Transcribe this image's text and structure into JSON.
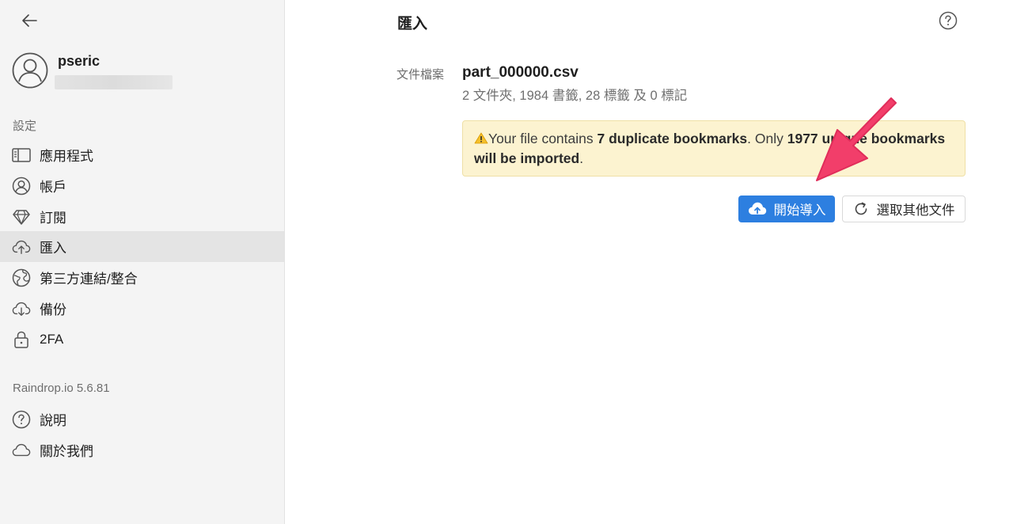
{
  "sidebar": {
    "back_icon": "arrow-left-icon",
    "user": {
      "name": "pseric",
      "avatar_icon": "user-avatar-icon"
    },
    "settings_label": "設定",
    "items": [
      {
        "label": "應用程式",
        "icon": "sidebar-layout-icon",
        "active": false
      },
      {
        "label": "帳戶",
        "icon": "user-circle-icon",
        "active": false
      },
      {
        "label": "訂閱",
        "icon": "diamond-icon",
        "active": false
      },
      {
        "label": "匯入",
        "icon": "cloud-upload-icon",
        "active": true
      },
      {
        "label": "第三方連結/整合",
        "icon": "globe-icon",
        "active": false
      },
      {
        "label": "備份",
        "icon": "cloud-download-icon",
        "active": false
      },
      {
        "label": "2FA",
        "icon": "lock-icon",
        "active": false
      }
    ],
    "version_label": "Raindrop.io 5.6.81",
    "footer_items": [
      {
        "label": "說明",
        "icon": "question-circle-icon"
      },
      {
        "label": "關於我們",
        "icon": "cloud-icon"
      }
    ]
  },
  "main": {
    "title": "匯入",
    "help_icon": "question-circle-icon",
    "file_label": "文件檔案",
    "file_name": "part_000000.csv",
    "file_stats": "2 文件夾, 1984 書籤, 28 標籤 及 0 標記",
    "warning": {
      "icon": "warning-icon",
      "prefix": "Your file contains ",
      "bold1": "7 duplicate bookmarks",
      "middle": ". Only ",
      "bold2": "1977 unique bookmarks will be imported",
      "suffix": "."
    },
    "primary_button": {
      "label": "開始導入",
      "icon": "cloud-upload-icon"
    },
    "secondary_button": {
      "label": "選取其他文件",
      "icon": "refresh-icon"
    },
    "annotation": {
      "icon": "pink-arrow-icon",
      "color": "#f23e6a"
    }
  },
  "colors": {
    "accent": "#2d7fe0",
    "sidebar_bg": "#f4f4f4",
    "active_bg": "#e4e4e4",
    "warning_bg": "#fcf3d0"
  }
}
